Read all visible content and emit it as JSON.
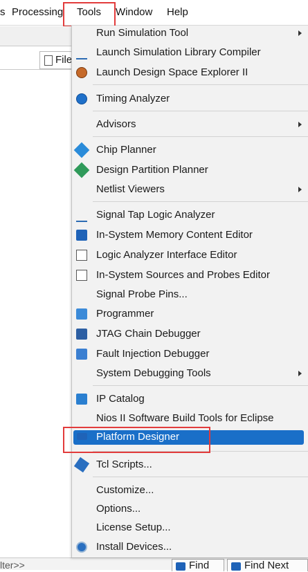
{
  "menubar": {
    "items": [
      "Processing",
      "Tools",
      "Window",
      "Help"
    ],
    "partial_left": "s"
  },
  "background": {
    "files_tab": "Files",
    "filter_text": "lter>>",
    "find_button": "Find",
    "find_next_button": "Find Next"
  },
  "menu": {
    "items": [
      {
        "label": "Run Simulation Tool",
        "submenu": true,
        "icon": null
      },
      {
        "label": "Launch Simulation Library Compiler",
        "icon": "sim-library-icon"
      },
      {
        "label": "Launch Design Space Explorer II",
        "icon": "design-space-explorer-icon"
      },
      {
        "label": "Timing Analyzer",
        "icon": "timing-analyzer-icon"
      },
      {
        "label": "Advisors",
        "submenu": true,
        "icon": null
      },
      {
        "label": "Chip Planner",
        "icon": "chip-planner-icon"
      },
      {
        "label": "Design Partition Planner",
        "icon": "design-partition-icon"
      },
      {
        "label": "Netlist Viewers",
        "submenu": true,
        "icon": null
      },
      {
        "label": "Signal Tap Logic Analyzer",
        "icon": "signal-tap-icon"
      },
      {
        "label": "In-System Memory Content Editor",
        "icon": "memory-editor-icon"
      },
      {
        "label": "Logic Analyzer Interface Editor",
        "icon": "logic-analyzer-interface-icon"
      },
      {
        "label": "In-System Sources and Probes Editor",
        "icon": "sources-probes-icon"
      },
      {
        "label": "Signal Probe Pins...",
        "icon": null
      },
      {
        "label": "Programmer",
        "icon": "programmer-icon"
      },
      {
        "label": "JTAG Chain Debugger",
        "icon": "jtag-icon"
      },
      {
        "label": "Fault Injection Debugger",
        "icon": "fault-injection-icon"
      },
      {
        "label": "System Debugging Tools",
        "submenu": true,
        "icon": null
      },
      {
        "label": "IP Catalog",
        "icon": "ip-catalog-icon"
      },
      {
        "label": "Nios II Software Build Tools for Eclipse",
        "icon": null
      },
      {
        "label": "Platform Designer",
        "icon": "platform-designer-icon",
        "selected": true
      },
      {
        "label": "Tcl Scripts...",
        "icon": "tcl-scripts-icon"
      },
      {
        "label": "Customize...",
        "icon": null
      },
      {
        "label": "Options...",
        "icon": null
      },
      {
        "label": "License Setup...",
        "icon": null
      },
      {
        "label": "Install Devices...",
        "icon": "install-devices-icon"
      }
    ]
  },
  "colors": {
    "selection": "#1a6fc8",
    "highlight_box": "#e23b3b",
    "menu_bg": "#f2f2f2"
  }
}
